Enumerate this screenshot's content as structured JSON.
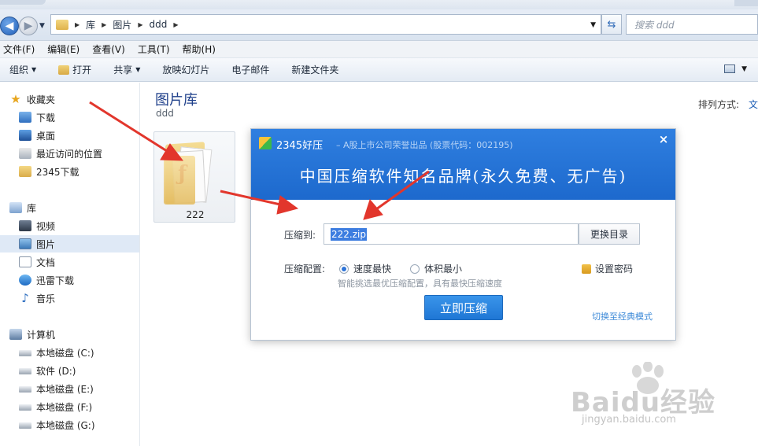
{
  "address_bar": {
    "crumbs": [
      "库",
      "图片",
      "ddd"
    ],
    "search_placeholder": "搜索 ddd"
  },
  "menu": [
    "文件(F)",
    "编辑(E)",
    "查看(V)",
    "工具(T)",
    "帮助(H)"
  ],
  "toolbar": {
    "organize": "组织",
    "open": "打开",
    "share": "共享",
    "slideshow": "放映幻灯片",
    "email": "电子邮件",
    "new_folder": "新建文件夹"
  },
  "sidebar": {
    "favorites": {
      "label": "收藏夹",
      "items": [
        "下载",
        "桌面",
        "最近访问的位置",
        "2345下载"
      ]
    },
    "libraries": {
      "label": "库",
      "items": [
        "视频",
        "图片",
        "文档",
        "迅雷下载",
        "音乐"
      ]
    },
    "computer": {
      "label": "计算机",
      "items": [
        "本地磁盘 (C:)",
        "软件 (D:)",
        "本地磁盘 (E:)",
        "本地磁盘 (F:)",
        "本地磁盘 (G:)"
      ]
    }
  },
  "main": {
    "library_title": "图片库",
    "library_subtitle": "ddd",
    "sort_label": "排列方式:",
    "sort_value": "文",
    "folder_name": "222"
  },
  "dialog": {
    "app_name": "2345好压",
    "tagline": "– A股上市公司荣誉出品 (股票代码：002195)",
    "close": "×",
    "slogan": "中国压缩软件知名品牌(永久免费、无广告)",
    "path_label": "压缩到:",
    "path_value": "222.zip",
    "change_dir": "更换目录",
    "config_label": "压缩配置:",
    "option_fast": "速度最快",
    "option_small": "体积最小",
    "hint": "智能挑选最优压缩配置，具有最快压缩速度",
    "password": "设置密码",
    "compress_now": "立即压缩",
    "classic_mode": "切换至经典模式"
  },
  "watermark": {
    "brand": "Baidu经验",
    "url": "jingyan.baidu.com"
  },
  "colors": {
    "dialog_blue": "#1d69cd",
    "button_blue": "#1f77d5",
    "arrow_red": "#e2362c"
  }
}
